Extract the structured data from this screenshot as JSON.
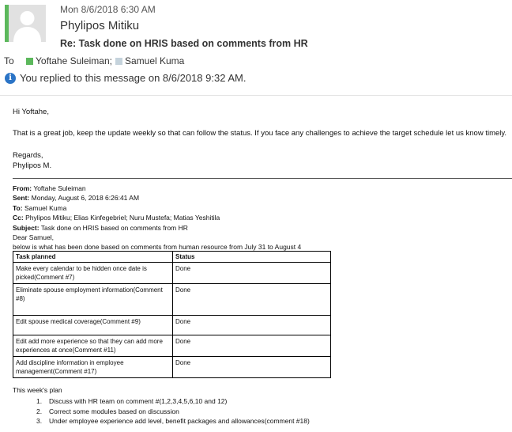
{
  "header": {
    "date": "Mon 8/6/2018 6:30 AM",
    "sender": "Phylipos Mitiku",
    "subject": "Re: Task done on HRIS based on comments from HR",
    "to_label": "To",
    "recipients": [
      "Yoftahe Suleiman;",
      "Samuel Kuma"
    ],
    "info_text": "You replied to this message on 8/6/2018 9:32 AM.",
    "accent_color": "#5cb85c",
    "info_icon": "info-icon"
  },
  "reply": {
    "greeting": "Hi Yoftahe,",
    "body": "That is a great job, keep the update weekly so that can follow the status. If you face any challenges to achieve the target schedule let us know timely.",
    "closing": "Regards,",
    "signature": "Phylipos M."
  },
  "original": {
    "from_label": "From:",
    "from": "Yoftahe Suleiman",
    "sent_label": "Sent:",
    "sent": "Monday, August 6, 2018 6:26:41 AM",
    "to_label": "To:",
    "to": "Samuel Kuma",
    "cc_label": "Cc:",
    "cc": "Phylipos Mitiku; Elias Kinfegebriel; Nuru Mustefa; Matias Yeshitila",
    "subject_label": "Subject:",
    "subject": "Task done on HRIS based on comments from HR",
    "salutation": "Dear Samuel,",
    "intro": "below is what has been done based on comments from human resource from July 31 to August 4",
    "table": {
      "headers": [
        "Task planned",
        "Status"
      ],
      "rows": [
        [
          "Make every calendar to be hidden once date is picked(Comment #7)",
          "Done"
        ],
        [
          "Eliminate spouse employment information(Comment #8)",
          "Done"
        ],
        [
          "Edit spouse medical coverage(Comment #9)",
          "Done"
        ],
        [
          "Edit add more experience so that they can add more experiences at once(Comment #11)",
          "Done"
        ],
        [
          "Add discipline information in employee management(Comment #17)",
          "Done"
        ]
      ]
    },
    "plan_title": "This week's plan",
    "plan_items": [
      {
        "n": "1.",
        "text": "Discuss with HR team on comment #(1,2,3,4,5,6,10 and 12)"
      },
      {
        "n": "2.",
        "text": "Correct some modules based on discussion"
      },
      {
        "n": "3.",
        "text": "Under employee experience add level, benefit packages and allowances(comment #18)"
      }
    ]
  }
}
